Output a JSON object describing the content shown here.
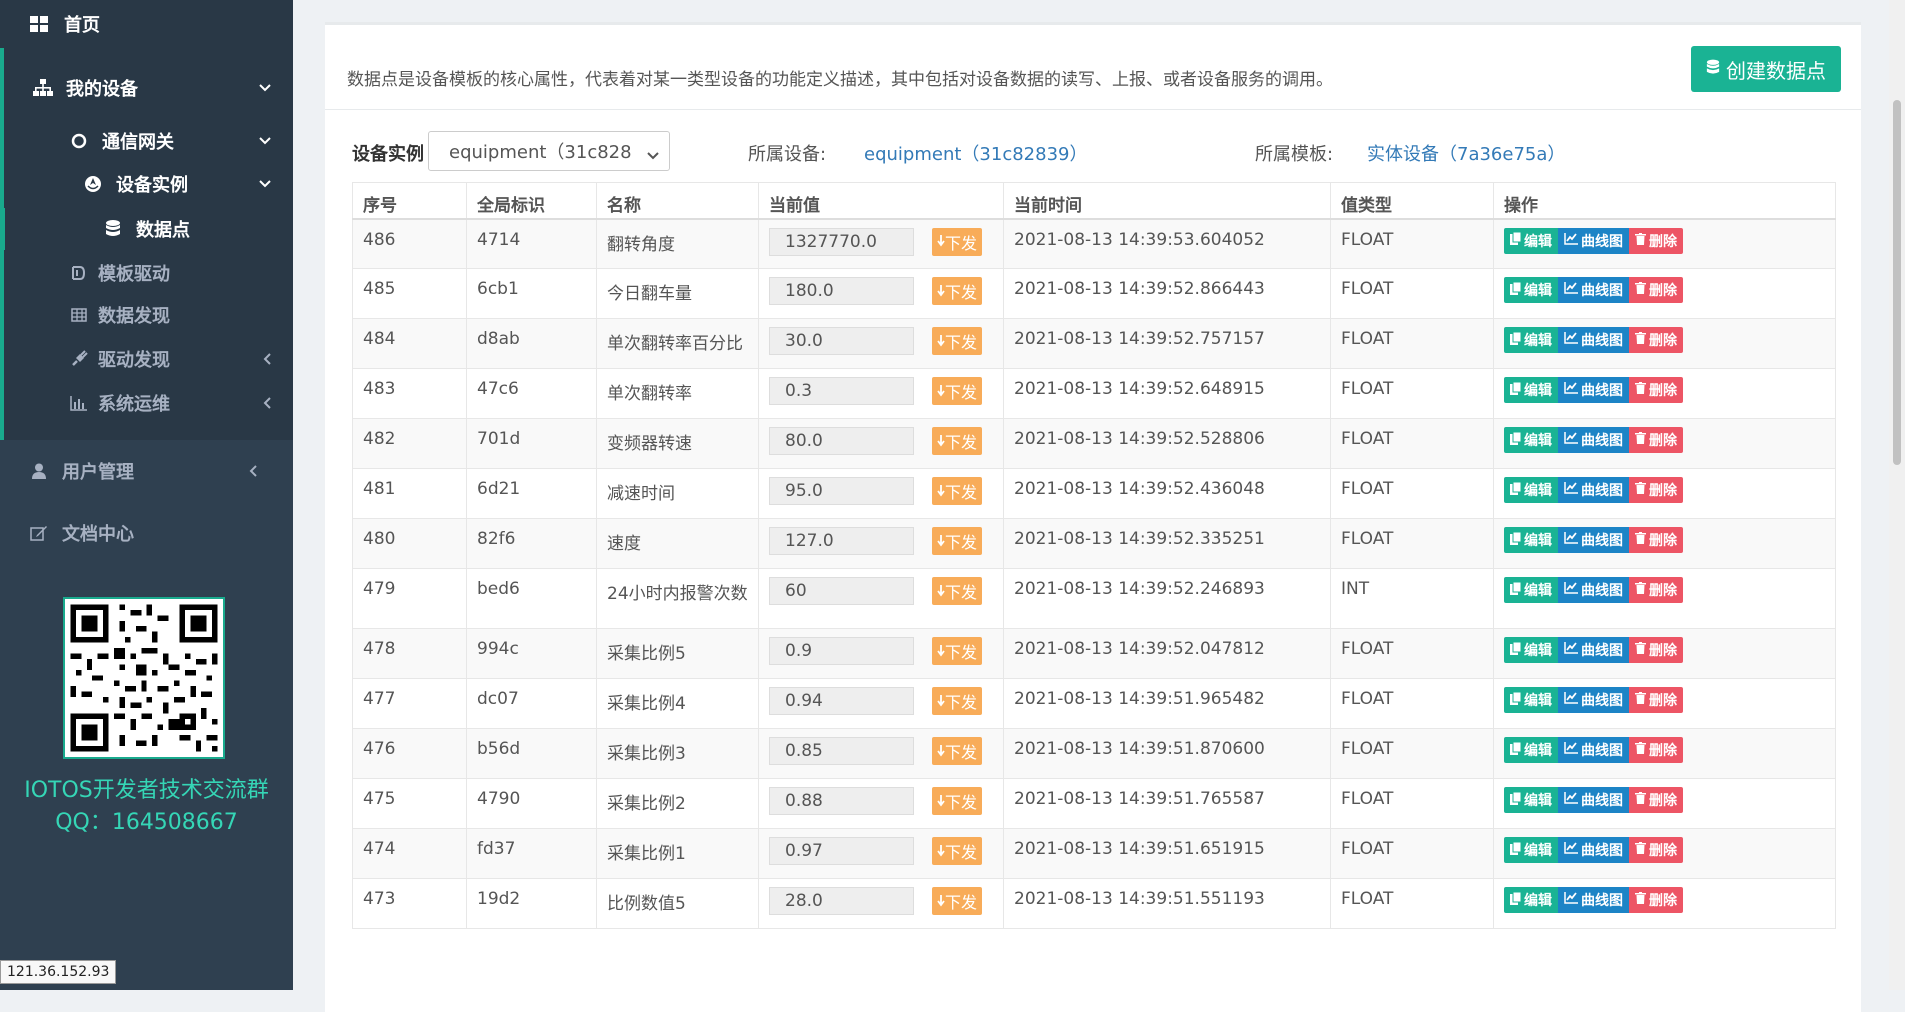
{
  "sidebar": {
    "home": "首页",
    "my_devices": "我的设备",
    "gateway": "通信网关",
    "instance": "设备实例",
    "datapoint": "数据点",
    "template_driver": "模板驱动",
    "data_discovery": "数据发现",
    "driver_discovery": "驱动发现",
    "ops": "系统运维",
    "user_mgmt": "用户管理",
    "docs": "文档中心",
    "qr_title": "IOTOS开发者技术交流群",
    "qr_qq": "QQ：164508667",
    "ip_tooltip": "121.36.152.93"
  },
  "header": {
    "description": "数据点是设备模板的核心属性，代表着对某一类型设备的功能定义描述，其中包括对设备数据的读写、上报、或者设备服务的调用。",
    "create_button": "创建数据点"
  },
  "filter": {
    "label": "设备实例",
    "selected": "equipment（31c828",
    "device_label": "所属设备:",
    "device_value": "equipment（31c82839）",
    "template_label": "所属模板:",
    "template_value": "实体设备（7a36e75a）"
  },
  "table": {
    "columns": [
      "序号",
      "全局标识",
      "名称",
      "当前值",
      "当前时间",
      "值类型",
      "操作"
    ],
    "send_label": "下发",
    "edit_label": "编辑",
    "chart_label": "曲线图",
    "delete_label": "删除",
    "rows": [
      {
        "seq": "486",
        "gid": "4714",
        "name": "翻转角度",
        "value": "1327770.0",
        "time": "2021-08-13 14:39:53.604052",
        "type": "FLOAT"
      },
      {
        "seq": "485",
        "gid": "6cb1",
        "name": "今日翻车量",
        "value": "180.0",
        "time": "2021-08-13 14:39:52.866443",
        "type": "FLOAT"
      },
      {
        "seq": "484",
        "gid": "d8ab",
        "name": "单次翻转率百分比",
        "value": "30.0",
        "time": "2021-08-13 14:39:52.757157",
        "type": "FLOAT"
      },
      {
        "seq": "483",
        "gid": "47c6",
        "name": "单次翻转率",
        "value": "0.3",
        "time": "2021-08-13 14:39:52.648915",
        "type": "FLOAT"
      },
      {
        "seq": "482",
        "gid": "701d",
        "name": "变频器转速",
        "value": "80.0",
        "time": "2021-08-13 14:39:52.528806",
        "type": "FLOAT"
      },
      {
        "seq": "481",
        "gid": "6d21",
        "name": "减速时间",
        "value": "95.0",
        "time": "2021-08-13 14:39:52.436048",
        "type": "FLOAT"
      },
      {
        "seq": "480",
        "gid": "82f6",
        "name": "速度",
        "value": "127.0",
        "time": "2021-08-13 14:39:52.335251",
        "type": "FLOAT"
      },
      {
        "seq": "479",
        "gid": "bed6",
        "name": "24小时内报警次数",
        "value": "60",
        "time": "2021-08-13 14:39:52.246893",
        "type": "INT"
      },
      {
        "seq": "478",
        "gid": "994c",
        "name": "采集比例5",
        "value": "0.9",
        "time": "2021-08-13 14:39:52.047812",
        "type": "FLOAT"
      },
      {
        "seq": "477",
        "gid": "dc07",
        "name": "采集比例4",
        "value": "0.94",
        "time": "2021-08-13 14:39:51.965482",
        "type": "FLOAT"
      },
      {
        "seq": "476",
        "gid": "b56d",
        "name": "采集比例3",
        "value": "0.85",
        "time": "2021-08-13 14:39:51.870600",
        "type": "FLOAT"
      },
      {
        "seq": "475",
        "gid": "4790",
        "name": "采集比例2",
        "value": "0.88",
        "time": "2021-08-13 14:39:51.765587",
        "type": "FLOAT"
      },
      {
        "seq": "474",
        "gid": "fd37",
        "name": "采集比例1",
        "value": "0.97",
        "time": "2021-08-13 14:39:51.651915",
        "type": "FLOAT"
      },
      {
        "seq": "473",
        "gid": "19d2",
        "name": "比例数值5",
        "value": "28.0",
        "time": "2021-08-13 14:39:51.551193",
        "type": "FLOAT"
      }
    ]
  },
  "colors": {
    "sidebar_bg": "#2f4050",
    "accent_green": "#1ab394",
    "chart_blue": "#1c84c6",
    "delete_red": "#ed5565",
    "send_orange": "#f8ac59",
    "link_blue": "#337ab7"
  },
  "icons": {
    "home": "th-large-icon",
    "my_devices": "sitemap-icon",
    "gateway": "circle-o-icon",
    "instance": "rebel-icon",
    "datapoint": "database-icon",
    "template_driver": "driver-icon",
    "data_discovery": "table-icon",
    "driver_discovery": "plug-icon",
    "ops": "bar-chart-icon",
    "user_mgmt": "user-icon",
    "docs": "edit-icon"
  }
}
